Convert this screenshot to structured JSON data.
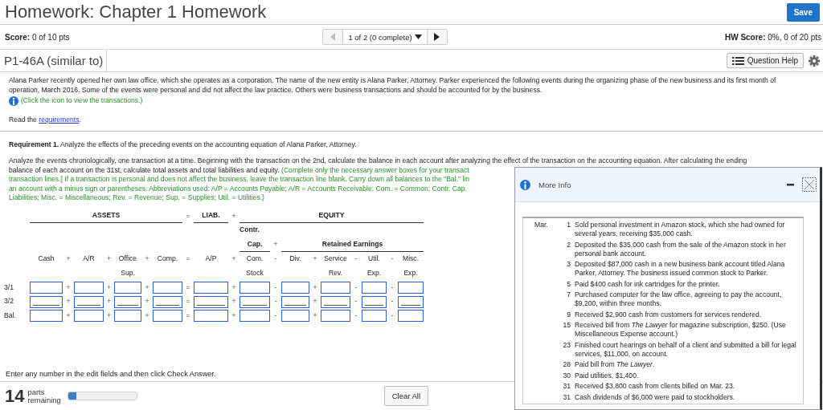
{
  "header": {
    "title": "Homework: Chapter 1 Homework",
    "save_button": "Save"
  },
  "score_bar": {
    "score_label": "Score:",
    "score": "0 of 10 pts",
    "question_nav": "1 of 2 (0 complete)",
    "hw_score_label": "HW Score:",
    "hw_score": "0%, 0 of 20 pts"
  },
  "question_bar": {
    "question_id": "P1-46A (similar to)",
    "help_button": "Question Help"
  },
  "intro": "Alana Parker recently opened her own law office, which she operates as a corporation. The name of the new entity is Alana Parker, Attorney. Parker experienced the following events during the organizing phase of the new business and its first month of operation, March 2016. Some of the events were personal and did not affect the law practice. Others were business transactions and should be accounted for by the business.",
  "transactions_link": "(Click the icon to view the transactions.)",
  "read_requirements": {
    "before": "Read the ",
    "link": "requirements",
    "after": "."
  },
  "requirement": "**Requirement 1.** Analyze the effects of the preceding events on the accounting equation of Alana Parker, Attorney.",
  "instructions": [
    [
      {
        "kind": "plain",
        "text": "Analyze the events chronologically, one transaction at a time. Beginning with the transaction on the 2nd, calculate the balance in each account after analyzing the effect of the transaction on the accounting equation. After calculating the ending"
      }
    ],
    [
      {
        "kind": "plain",
        "text": "balance of each account on the 31st, calculate total assets and total liabilities and equity. "
      },
      {
        "kind": "hint",
        "text": "(Complete only the necessary answer boxes for your transact"
      }
    ],
    [
      {
        "kind": "hint",
        "text": "transaction lines.] If a transaction is personal and does not affect the business, leave the transaction line blank. Carry down all balances to the \"Bal.\" lin"
      }
    ],
    [
      {
        "kind": "hint",
        "text": "an account with a minus sign or parentheses. Abbreviations used: A/P = Accounts Payable; A/R = Accounts Receivable; Com. = Common; Contr. Cap."
      }
    ],
    [
      {
        "kind": "hint",
        "text": "Liabilities; Misc. = Miscellaneous; Rev. = Revenue; Sup. = Supplies; Util. = Utilities.)"
      }
    ]
  ],
  "table": {
    "groups": [
      {
        "label": "ASSETS"
      },
      {
        "op": "=",
        "label": "LIAB."
      },
      {
        "op": "+",
        "label": "EQUITY"
      }
    ],
    "equity_subgroups": [
      {
        "lines": [
          "Contr.",
          "Cap."
        ]
      },
      {
        "op": "+",
        "lines": [
          "Retained Earnings"
        ]
      }
    ],
    "accounts": [
      {
        "lines": [
          "Cash"
        ]
      },
      {
        "op": "+",
        "lines": [
          "A/R"
        ]
      },
      {
        "op": "+",
        "lines": [
          "Office",
          "Sup."
        ]
      },
      {
        "op": "+",
        "lines": [
          "Comp."
        ]
      },
      {
        "op": "=",
        "lines": [
          "A/P"
        ]
      },
      {
        "op": "+",
        "lines": [
          "Com.",
          "Stock"
        ]
      },
      {
        "op": "-",
        "lines": [
          "Div."
        ]
      },
      {
        "op": "+",
        "lines": [
          "Service",
          "Rev."
        ]
      },
      {
        "op": "-",
        "lines": [
          "Util.",
          "Exp."
        ]
      },
      {
        "op": "-",
        "lines": [
          "Misc.",
          "Exp."
        ]
      }
    ],
    "rows": [
      {
        "label": "3/1",
        "ops": [
          "+",
          "+",
          "+",
          "=",
          "+",
          "-",
          "+",
          "-",
          "-"
        ],
        "blank_line": false
      },
      {
        "label": "3/2",
        "ops": [
          "+",
          "+",
          "+",
          "=",
          "+",
          "-",
          "+",
          "-",
          "-"
        ],
        "blank_line": true
      },
      {
        "label": "Bal.",
        "ops": [
          "+",
          "+",
          "+",
          "=",
          "+",
          "-",
          "+",
          "-",
          "-"
        ],
        "blank_line": false
      }
    ]
  },
  "footer_hint": "Enter any number in the edit fields and then click Check Answer.",
  "progress": {
    "count": "14",
    "label_lines": [
      "parts",
      "remaining"
    ],
    "level": 0.12
  },
  "clear_button": "Clear All",
  "more_info": {
    "title": "More Info",
    "month": "Mar.",
    "events": [
      {
        "day": "1",
        "text": "Sold personal investment in Amazon stock, which she had owned for several years, receiving $35,000 cash."
      },
      {
        "day": "2",
        "text": "Deposited the $35,000 cash from the sale of the Amazon stock in her personal bank account."
      },
      {
        "day": "3",
        "text": "Deposited $87,000 cash in a new business bank account titled Alana Parker, Attorney. The business issued common stock to Parker."
      },
      {
        "day": "5",
        "text": "Paid $400 cash for ink cartridges for the printer."
      },
      {
        "day": "7",
        "text": "Purchased computer for the law office, agreeing to pay the account, $9,200, within three months."
      },
      {
        "day": "9",
        "text": "Received $2,900 cash from customers for services rendered."
      },
      {
        "day": "15",
        "text": "Received bill from *The Lawyer* for magazine subscription, $250. (Use Miscellaneous Expense account.)"
      },
      {
        "day": "23",
        "text": "Finished court hearings on behalf of a client and submitted a bill for legal services, $11,000, on account."
      },
      {
        "day": "28",
        "text": "Paid bill from *The Lawyer*."
      },
      {
        "day": "30",
        "text": "Paid utilities, $1,400."
      },
      {
        "day": "31",
        "text": "Received $3,800 cash from clients billed on Mar. 23."
      },
      {
        "day": "31",
        "text": "Cash dividends of $6,000 were paid to stockholders."
      }
    ]
  }
}
